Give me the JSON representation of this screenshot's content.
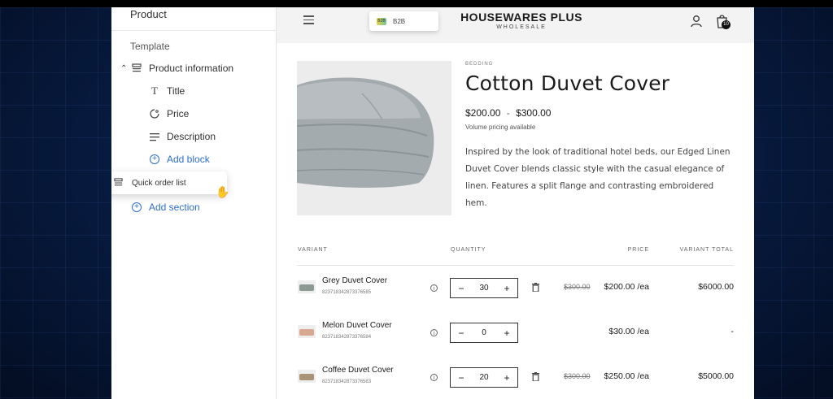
{
  "sidebar": {
    "title": "Product",
    "template_label": "Template",
    "section": {
      "label": "Product information"
    },
    "blocks": [
      {
        "label": "Title",
        "icon": "text-icon"
      },
      {
        "label": "Price",
        "icon": "price-tag-icon"
      },
      {
        "label": "Description",
        "icon": "paragraph-icon"
      }
    ],
    "add_block_label": "Add block",
    "add_section_label": "Add section",
    "drag_item_label": "Quick order list"
  },
  "store": {
    "market_badge": "B2B",
    "market_badge_swatch": "B2B",
    "brand_name": "HOUSEWARES PLUS",
    "brand_sub": "WHOLESALE",
    "cart_count": "10",
    "product": {
      "category": "BEDDING",
      "title": "Cotton Duvet Cover",
      "price_min": "$200.00",
      "price_sep": "-",
      "price_max": "$300.00",
      "volume_note": "Volume pricing available",
      "description": "Inspired by the look of traditional hotel beds, our Edged Linen Duvet Cover blends classic style with the casual elegance of linen. Features a split flange and contrasting embroidered hem."
    },
    "table": {
      "headers": {
        "variant": "VARIANT",
        "quantity": "QUANTITY",
        "price": "PRICE",
        "total": "VARIANT TOTAL"
      },
      "rows": [
        {
          "name": "Grey Duvet Cover",
          "sku": "823718342873376585",
          "qty": "30",
          "orig_price": "$300.00",
          "price": "$200.00 /ea",
          "total": "$6000.00",
          "thumb_color": "#8c9a93"
        },
        {
          "name": "Melon Duvet Cover",
          "sku": "823718342873376584",
          "qty": "0",
          "orig_price": "",
          "price": "$30.00 /ea",
          "total": "-",
          "thumb_color": "#d8a890"
        },
        {
          "name": "Coffee Duvet Cover",
          "sku": "823718342873376583",
          "qty": "20",
          "orig_price": "$300.00",
          "price": "$250.00 /ea",
          "total": "$5000.00",
          "thumb_color": "#a99478"
        }
      ]
    }
  },
  "colors": {
    "accent": "#2c6ecb",
    "background": "#071a3e"
  }
}
